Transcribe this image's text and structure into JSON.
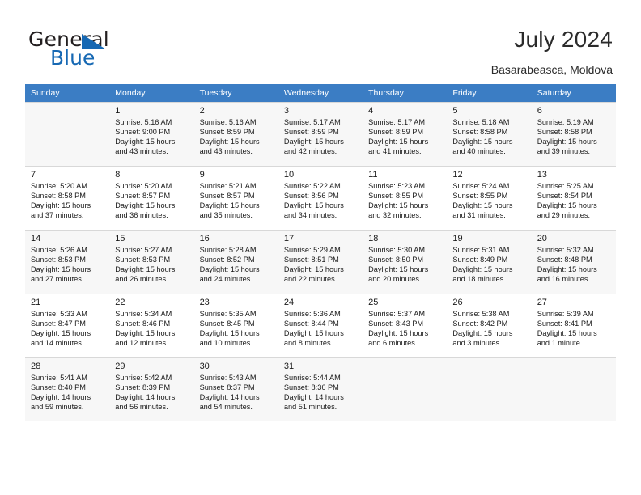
{
  "brand": {
    "name_top": "General",
    "name_bottom": "Blue",
    "accent_color": "#1668b3"
  },
  "header": {
    "title": "July 2024",
    "subtitle": "Basarabeasca, Moldova"
  },
  "calendar": {
    "header_bg": "#3b7dc4",
    "weekdays": [
      "Sunday",
      "Monday",
      "Tuesday",
      "Wednesday",
      "Thursday",
      "Friday",
      "Saturday"
    ],
    "weeks": [
      [
        {
          "day": "",
          "detail": ""
        },
        {
          "day": "1",
          "detail": "Sunrise: 5:16 AM\nSunset: 9:00 PM\nDaylight: 15 hours\nand 43 minutes."
        },
        {
          "day": "2",
          "detail": "Sunrise: 5:16 AM\nSunset: 8:59 PM\nDaylight: 15 hours\nand 43 minutes."
        },
        {
          "day": "3",
          "detail": "Sunrise: 5:17 AM\nSunset: 8:59 PM\nDaylight: 15 hours\nand 42 minutes."
        },
        {
          "day": "4",
          "detail": "Sunrise: 5:17 AM\nSunset: 8:59 PM\nDaylight: 15 hours\nand 41 minutes."
        },
        {
          "day": "5",
          "detail": "Sunrise: 5:18 AM\nSunset: 8:58 PM\nDaylight: 15 hours\nand 40 minutes."
        },
        {
          "day": "6",
          "detail": "Sunrise: 5:19 AM\nSunset: 8:58 PM\nDaylight: 15 hours\nand 39 minutes."
        }
      ],
      [
        {
          "day": "7",
          "detail": "Sunrise: 5:20 AM\nSunset: 8:58 PM\nDaylight: 15 hours\nand 37 minutes."
        },
        {
          "day": "8",
          "detail": "Sunrise: 5:20 AM\nSunset: 8:57 PM\nDaylight: 15 hours\nand 36 minutes."
        },
        {
          "day": "9",
          "detail": "Sunrise: 5:21 AM\nSunset: 8:57 PM\nDaylight: 15 hours\nand 35 minutes."
        },
        {
          "day": "10",
          "detail": "Sunrise: 5:22 AM\nSunset: 8:56 PM\nDaylight: 15 hours\nand 34 minutes."
        },
        {
          "day": "11",
          "detail": "Sunrise: 5:23 AM\nSunset: 8:55 PM\nDaylight: 15 hours\nand 32 minutes."
        },
        {
          "day": "12",
          "detail": "Sunrise: 5:24 AM\nSunset: 8:55 PM\nDaylight: 15 hours\nand 31 minutes."
        },
        {
          "day": "13",
          "detail": "Sunrise: 5:25 AM\nSunset: 8:54 PM\nDaylight: 15 hours\nand 29 minutes."
        }
      ],
      [
        {
          "day": "14",
          "detail": "Sunrise: 5:26 AM\nSunset: 8:53 PM\nDaylight: 15 hours\nand 27 minutes."
        },
        {
          "day": "15",
          "detail": "Sunrise: 5:27 AM\nSunset: 8:53 PM\nDaylight: 15 hours\nand 26 minutes."
        },
        {
          "day": "16",
          "detail": "Sunrise: 5:28 AM\nSunset: 8:52 PM\nDaylight: 15 hours\nand 24 minutes."
        },
        {
          "day": "17",
          "detail": "Sunrise: 5:29 AM\nSunset: 8:51 PM\nDaylight: 15 hours\nand 22 minutes."
        },
        {
          "day": "18",
          "detail": "Sunrise: 5:30 AM\nSunset: 8:50 PM\nDaylight: 15 hours\nand 20 minutes."
        },
        {
          "day": "19",
          "detail": "Sunrise: 5:31 AM\nSunset: 8:49 PM\nDaylight: 15 hours\nand 18 minutes."
        },
        {
          "day": "20",
          "detail": "Sunrise: 5:32 AM\nSunset: 8:48 PM\nDaylight: 15 hours\nand 16 minutes."
        }
      ],
      [
        {
          "day": "21",
          "detail": "Sunrise: 5:33 AM\nSunset: 8:47 PM\nDaylight: 15 hours\nand 14 minutes."
        },
        {
          "day": "22",
          "detail": "Sunrise: 5:34 AM\nSunset: 8:46 PM\nDaylight: 15 hours\nand 12 minutes."
        },
        {
          "day": "23",
          "detail": "Sunrise: 5:35 AM\nSunset: 8:45 PM\nDaylight: 15 hours\nand 10 minutes."
        },
        {
          "day": "24",
          "detail": "Sunrise: 5:36 AM\nSunset: 8:44 PM\nDaylight: 15 hours\nand 8 minutes."
        },
        {
          "day": "25",
          "detail": "Sunrise: 5:37 AM\nSunset: 8:43 PM\nDaylight: 15 hours\nand 6 minutes."
        },
        {
          "day": "26",
          "detail": "Sunrise: 5:38 AM\nSunset: 8:42 PM\nDaylight: 15 hours\nand 3 minutes."
        },
        {
          "day": "27",
          "detail": "Sunrise: 5:39 AM\nSunset: 8:41 PM\nDaylight: 15 hours\nand 1 minute."
        }
      ],
      [
        {
          "day": "28",
          "detail": "Sunrise: 5:41 AM\nSunset: 8:40 PM\nDaylight: 14 hours\nand 59 minutes."
        },
        {
          "day": "29",
          "detail": "Sunrise: 5:42 AM\nSunset: 8:39 PM\nDaylight: 14 hours\nand 56 minutes."
        },
        {
          "day": "30",
          "detail": "Sunrise: 5:43 AM\nSunset: 8:37 PM\nDaylight: 14 hours\nand 54 minutes."
        },
        {
          "day": "31",
          "detail": "Sunrise: 5:44 AM\nSunset: 8:36 PM\nDaylight: 14 hours\nand 51 minutes."
        },
        {
          "day": "",
          "detail": ""
        },
        {
          "day": "",
          "detail": ""
        },
        {
          "day": "",
          "detail": ""
        }
      ]
    ]
  }
}
